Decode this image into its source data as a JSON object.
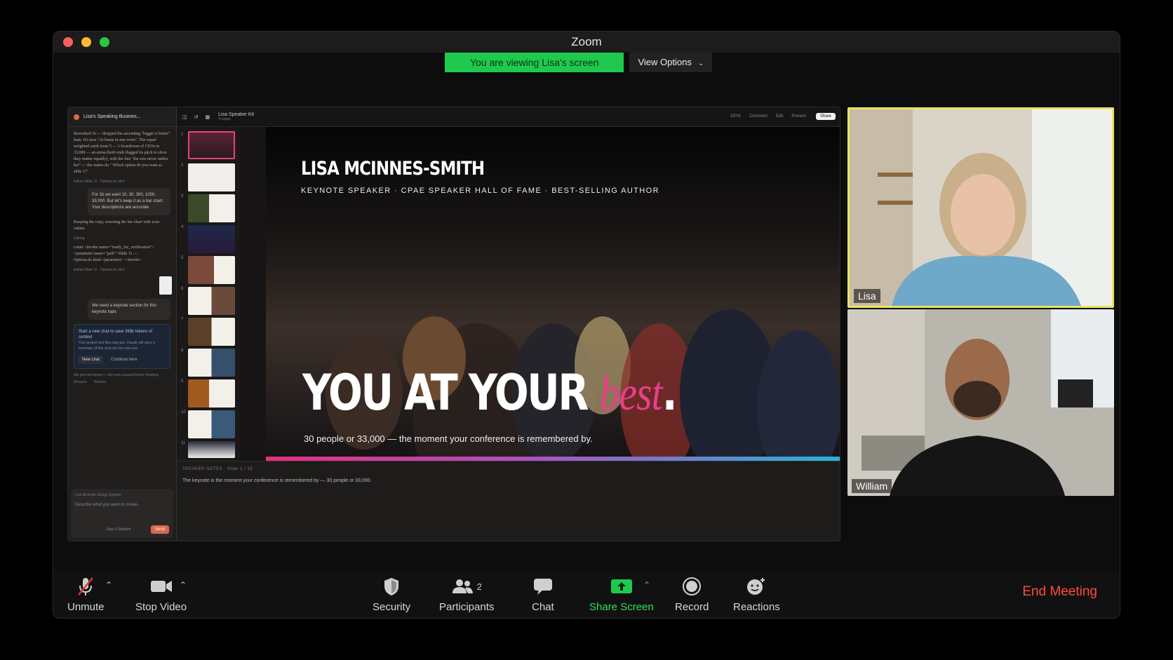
{
  "window": {
    "title": "Zoom"
  },
  "banner": {
    "viewing": "You are viewing Lisa's screen",
    "view_options": "View Options"
  },
  "shared_screen": {
    "chat": {
      "header": "Lisa's Speaking Busines...",
      "message1": "Reworked 1b — dropped the ascending \"bigger is better\" hum. It's now \"At home in any room\". The equal-weighted cards from 5 — 1 boardroom of CEOs to 33,000 — an arena (both ends flagged its pitch to show they matter equally), with the line \"the size never rattles her\" — the stakes do.\" Which option do you want as slide 1?\"",
      "meta1": "Edited Slide 11 · Options.dc.html",
      "bubble1": "For 1b we want 10, 30, 300, 1000, 33,000. But let's keep it as a bar chart. Your descriptions are accurate.",
      "message2": "Keeping the copy, restoring the bar chart with your values.",
      "meta_editing": "Editing",
      "message3": "count <invoke name=\"ready_for_verification\"> <parameter name=\"path\">Slide 11 — Options.dc.html</parameter> </invoke>",
      "meta2": "Edited Slide 11 · Options.dc.html",
      "bubble2": "We need a keynote section for this keynote topic",
      "notice_title": "Start a new chat to save 265k tokens of context",
      "notice_body": "Your project and files stay put. Claude will carry a summary of this chat into the new one.",
      "notice_btn1": "New chat",
      "notice_btn2": "Continue here",
      "interrupted": "We got interrupted — the work paused before finishing.",
      "resume": "Resume",
      "dismiss": "Dismiss",
      "input_context": "Lisa McSmith Design System",
      "input_placeholder": "Describe what you want to create...",
      "model": "Opus 6 Medium",
      "send": "Send"
    },
    "editor": {
      "doc_title": "Lisa Speaker Kit",
      "doc_sub": "4 pages",
      "zoom": "100%",
      "comment": "Comment",
      "edit": "Edit",
      "present": "Present",
      "share": "Share",
      "thumb_numbers": [
        "1",
        "2",
        "3",
        "4",
        "5",
        "6",
        "7",
        "8",
        "9",
        "10",
        "11"
      ],
      "notes_label": "SPEAKER NOTES · Slide 1 / 15",
      "notes_text": "The keynote is the moment your conference is remembered by — 30 people or 33,000."
    },
    "slide": {
      "name": "LISA MCINNES-SMITH",
      "subtitle": "KEYNOTE SPEAKER · CPAE SPEAKER HALL OF FAME · BEST-SELLING AUTHOR",
      "headline_part1": "YOU AT YOUR ",
      "headline_best": "best",
      "headline_period": ".",
      "caption": "30 people or 33,000 — the moment your conference is remembered by."
    }
  },
  "participants_video": {
    "lisa": "Lisa",
    "william": "William"
  },
  "controls": {
    "unmute": "Unmute",
    "stop_video": "Stop Video",
    "security": "Security",
    "participants": "Participants",
    "participants_count": "2",
    "chat": "Chat",
    "share_screen": "Share Screen",
    "record": "Record",
    "reactions": "Reactions",
    "end_meeting": "End Meeting"
  },
  "colors": {
    "share_green": "#1fc94d",
    "active_speaker": "#e8e45f",
    "end_red": "#ff4b3e",
    "accent_pink": "#e83e8c"
  }
}
